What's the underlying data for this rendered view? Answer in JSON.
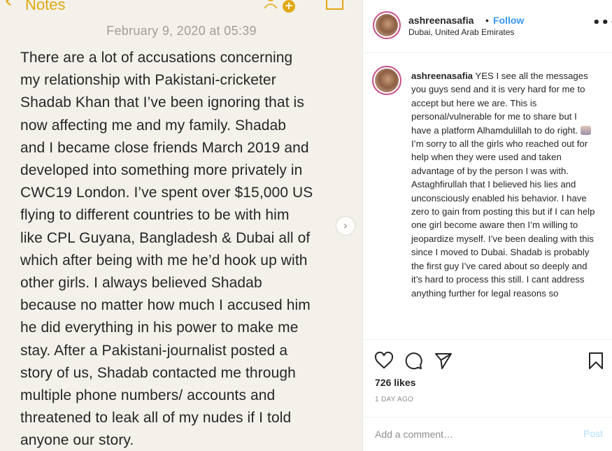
{
  "notes": {
    "back_label": "Notes",
    "date": "February 9, 2020 at 05:39",
    "lines": [
      "There are a lot of accusations concerning",
      "my relationship with Pakistani-cricketer",
      "Shadab Khan that I’ve been ignoring that is",
      "now affecting me and my family. Shadab",
      "and I became close friends March 2019 and",
      "developed into something more privately in",
      "CWC19 London. I’ve spent over $15,000 US",
      "flying to different countries to be with him",
      "like CPL Guyana, Bangladesh & Dubai all of",
      "which after being with me he’d hook up with",
      "other girls. I always believed Shadab",
      "because no matter how much I accused him",
      "he did everything in his power to make me",
      "stay. After a Pakistani-journalist posted a",
      "story of us, Shadab contacted me through",
      "multiple phone numbers/ accounts and",
      "threatened to leak all of my nudes if I told",
      "anyone our story."
    ]
  },
  "post": {
    "username": "ashreenasafia",
    "separator": "•",
    "follow_label": "Follow",
    "location": "Dubai, United Arab Emirates",
    "more_label": "•••",
    "caption_user": "ashreenasafia",
    "caption_part1": "YES I see all the messages you guys send and it is very hard for me to accept but here we are. This is personal/vulnerable for me to share but I have a platform Alhamdulillah to do right.",
    "caption_part2": "I’m sorry to all the girls who reached out for help when they were used and taken advantage of by the person I was with. Astaghfirullah that I believed his lies and unconsciously enabled his behavior. I have zero to gain from posting this but if I can help one girl become aware then I’m willing to jeopardize myself. I’ve been dealing with this since I moved to Dubai. Shadab is probably the first guy I’ve cared about so deeply and it’s hard to process this still. I cant address anything further for legal reasons so",
    "likes": "726 likes",
    "time_ago": "1 DAY AGO",
    "comment_placeholder": "Add a comment…",
    "post_label": "Post"
  },
  "colors": {
    "notes_accent": "#e0a814",
    "follow_blue": "#3897f0",
    "post_disabled": "#b2dffc",
    "story_ring": "#c9508a"
  },
  "icons": {
    "back": "chevron-left-icon",
    "add_people": "person-add-icon",
    "share": "share-icon",
    "next": "chevron-right-icon",
    "like": "heart-icon",
    "comment": "comment-icon",
    "send": "send-icon",
    "save": "bookmark-icon",
    "more": "more-icon"
  }
}
